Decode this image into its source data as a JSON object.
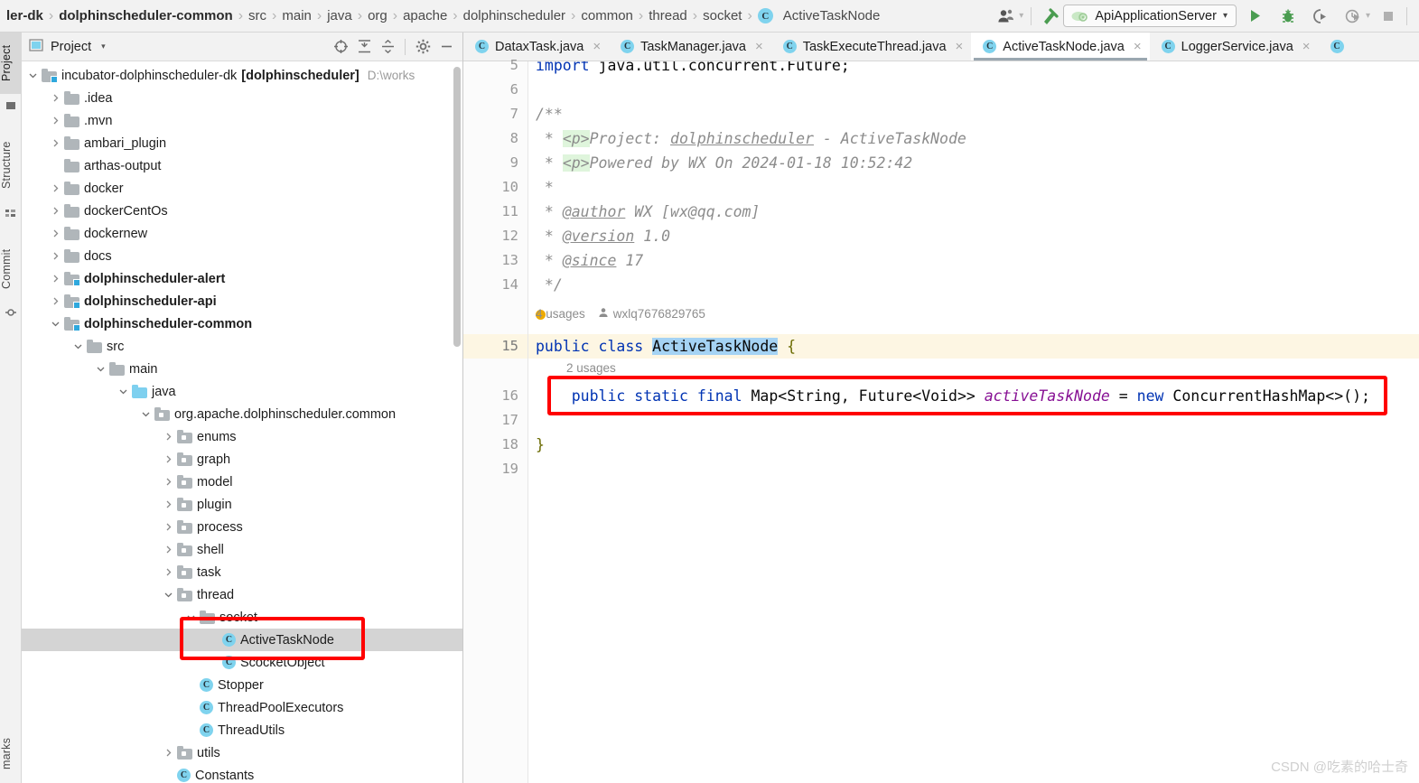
{
  "navbar": {
    "breadcrumbs": [
      {
        "label": "ler-dk",
        "bold": true
      },
      {
        "label": "dolphinscheduler-common",
        "bold": true
      },
      {
        "label": "src",
        "bold": false
      },
      {
        "label": "main",
        "bold": false
      },
      {
        "label": "java",
        "bold": false
      },
      {
        "label": "org",
        "bold": false
      },
      {
        "label": "apache",
        "bold": false
      },
      {
        "label": "dolphinscheduler",
        "bold": false
      },
      {
        "label": "common",
        "bold": false
      },
      {
        "label": "thread",
        "bold": false
      },
      {
        "label": "socket",
        "bold": false
      }
    ],
    "current_class": "ActiveTaskNode",
    "class_icon_letter": "C",
    "separator": "›",
    "icons": {
      "account": "account-icon",
      "account_caret": "▾",
      "build": "build-hammer-icon",
      "run": "run-icon",
      "debug": "debug-icon",
      "run_coverage": "run-with-coverage-icon",
      "profiler": "profiler-icon",
      "profiler_caret": "▾",
      "stop": "stop-icon"
    },
    "run_config": {
      "name": "ApiApplicationServer",
      "caret": "▾",
      "icon": "spring-boot-icon"
    }
  },
  "toolstrip": {
    "tabs": [
      {
        "label": "Project",
        "active": true
      },
      {
        "label": "Structure",
        "active": false
      },
      {
        "label": "Commit",
        "active": false
      },
      {
        "label": "marks",
        "active": false
      }
    ]
  },
  "project_panel": {
    "title": "Project",
    "title_caret": "▾",
    "tools": [
      {
        "name": "select-opened-file-icon",
        "glyph": "⊕"
      },
      {
        "name": "expand-all-icon",
        "glyph": "↧"
      },
      {
        "name": "collapse-all-icon",
        "glyph": "↥"
      },
      {
        "name": "settings-gear-icon",
        "glyph": "⚙"
      },
      {
        "name": "hide-panel-icon",
        "glyph": "—"
      }
    ],
    "tree": [
      {
        "label": "incubator-dolphinscheduler-dk",
        "suffix": "[dolphinscheduler]",
        "path": "D:\\works",
        "indent": 0,
        "twist": "down",
        "icon": "module",
        "bold": false
      },
      {
        "label": ".idea",
        "indent": 1,
        "twist": "right",
        "icon": "folder",
        "bold": false
      },
      {
        "label": ".mvn",
        "indent": 1,
        "twist": "right",
        "icon": "folder",
        "bold": false
      },
      {
        "label": "ambari_plugin",
        "indent": 1,
        "twist": "right",
        "icon": "folder",
        "bold": false
      },
      {
        "label": "arthas-output",
        "indent": 1,
        "twist": "none",
        "icon": "folder",
        "bold": false
      },
      {
        "label": "docker",
        "indent": 1,
        "twist": "right",
        "icon": "folder",
        "bold": false
      },
      {
        "label": "dockerCentOs",
        "indent": 1,
        "twist": "right",
        "icon": "folder",
        "bold": false
      },
      {
        "label": "dockernew",
        "indent": 1,
        "twist": "right",
        "icon": "folder",
        "bold": false
      },
      {
        "label": "docs",
        "indent": 1,
        "twist": "right",
        "icon": "folder",
        "bold": false
      },
      {
        "label": "dolphinscheduler-alert",
        "indent": 1,
        "twist": "right",
        "icon": "module",
        "bold": true
      },
      {
        "label": "dolphinscheduler-api",
        "indent": 1,
        "twist": "right",
        "icon": "module",
        "bold": true
      },
      {
        "label": "dolphinscheduler-common",
        "indent": 1,
        "twist": "down",
        "icon": "module",
        "bold": true
      },
      {
        "label": "src",
        "indent": 2,
        "twist": "down",
        "icon": "folder",
        "bold": false
      },
      {
        "label": "main",
        "indent": 3,
        "twist": "down",
        "icon": "folder",
        "bold": false
      },
      {
        "label": "java",
        "indent": 4,
        "twist": "down",
        "icon": "source",
        "bold": false
      },
      {
        "label": "org.apache.dolphinscheduler.common",
        "indent": 5,
        "twist": "down",
        "icon": "pkg",
        "bold": false
      },
      {
        "label": "enums",
        "indent": 6,
        "twist": "right",
        "icon": "pkg",
        "bold": false
      },
      {
        "label": "graph",
        "indent": 6,
        "twist": "right",
        "icon": "pkg",
        "bold": false
      },
      {
        "label": "model",
        "indent": 6,
        "twist": "right",
        "icon": "pkg",
        "bold": false
      },
      {
        "label": "plugin",
        "indent": 6,
        "twist": "right",
        "icon": "pkg",
        "bold": false
      },
      {
        "label": "process",
        "indent": 6,
        "twist": "right",
        "icon": "pkg",
        "bold": false
      },
      {
        "label": "shell",
        "indent": 6,
        "twist": "right",
        "icon": "pkg",
        "bold": false
      },
      {
        "label": "task",
        "indent": 6,
        "twist": "right",
        "icon": "pkg",
        "bold": false
      },
      {
        "label": "thread",
        "indent": 6,
        "twist": "down",
        "icon": "pkg",
        "bold": false
      },
      {
        "label": "socket",
        "indent": 7,
        "twist": "down",
        "icon": "folder",
        "bold": false
      },
      {
        "label": "ActiveTaskNode",
        "indent": 8,
        "twist": "none",
        "icon": "class",
        "bold": false,
        "selected": true
      },
      {
        "label": "ScocketObject",
        "indent": 8,
        "twist": "none",
        "icon": "class",
        "bold": false
      },
      {
        "label": "Stopper",
        "indent": 7,
        "twist": "none",
        "icon": "class",
        "bold": false
      },
      {
        "label": "ThreadPoolExecutors",
        "indent": 7,
        "twist": "none",
        "icon": "class",
        "bold": false
      },
      {
        "label": "ThreadUtils",
        "indent": 7,
        "twist": "none",
        "icon": "class",
        "bold": false
      },
      {
        "label": "utils",
        "indent": 6,
        "twist": "right",
        "icon": "pkg",
        "bold": false
      },
      {
        "label": "Constants",
        "indent": 6,
        "twist": "none",
        "icon": "class",
        "bold": false
      }
    ]
  },
  "editor": {
    "tabs": [
      {
        "label": "DataxTask.java",
        "active": false,
        "icon": "java-class-run-icon"
      },
      {
        "label": "TaskManager.java",
        "active": false,
        "icon": "java-class-icon"
      },
      {
        "label": "TaskExecuteThread.java",
        "active": false,
        "icon": "java-class-icon"
      },
      {
        "label": "ActiveTaskNode.java",
        "active": true,
        "icon": "java-class-icon"
      },
      {
        "label": "LoggerService.java",
        "active": false,
        "icon": "java-class-icon"
      },
      {
        "label": "",
        "active": false,
        "icon": "java-class-icon"
      }
    ],
    "close_glyph": "×",
    "line_numbers": [
      "5",
      "6",
      "7",
      "8",
      "9",
      "10",
      "11",
      "12",
      "13",
      "14",
      "15",
      "16",
      "17",
      "18",
      "19"
    ],
    "current_line": "15",
    "code_lines": [
      {
        "n": "5",
        "text": "import java.util.concurrent.Future;"
      },
      {
        "n": "6",
        "text": ""
      },
      {
        "n": "7",
        "text": "/**"
      },
      {
        "n": "8",
        "text": " * <p>Project: dolphinscheduler - ActiveTaskNode"
      },
      {
        "n": "9",
        "text": " * <p>Powered by WX On 2024-01-18 10:52:42"
      },
      {
        "n": "10",
        "text": " *"
      },
      {
        "n": "11",
        "text": " * @author WX [wx@qq.com]"
      },
      {
        "n": "12",
        "text": " * @version 1.0"
      },
      {
        "n": "13",
        "text": " * @since 17"
      },
      {
        "n": "14",
        "text": " */"
      },
      {
        "n": "15",
        "text": "public class ActiveTaskNode {"
      },
      {
        "n": "16",
        "text": "    public static final Map<String, Future<Void>> activeTaskNode = new ConcurrentHashMap<>();"
      },
      {
        "n": "17",
        "text": ""
      },
      {
        "n": "18",
        "text": "}"
      },
      {
        "n": "19",
        "text": ""
      }
    ],
    "code_tokens": {
      "import_kw": "import",
      "import_pkg": " java.util.concurrent.Future;",
      "doc_open": "/**",
      "doc_star": " * ",
      "ptag": "<p>",
      "line8_rest_a": "Project: ",
      "line8_link": "dolphinscheduler",
      "line8_rest_b": " - ActiveTaskNode",
      "line9_rest": "Powered by WX On 2024-01-18 10:52:42",
      "line10": " *",
      "author_tag": "@author",
      "author_val": " WX [wx@qq.com]",
      "version_tag": "@version",
      "version_val": " 1.0",
      "since_tag": "@since",
      "since_val": " 17",
      "doc_close": " */",
      "public": "public",
      "class": "class",
      "classname": "ActiveTaskNode",
      "open_brace": "{",
      "indent": "    ",
      "static": "static",
      "final": "final",
      "maptype": "Map<String, ",
      "futuretype": "Future<Void>>",
      "fieldname": "activeTaskNode",
      "equals": "=",
      "new": "new",
      "ctor": "ConcurrentHashMap<>();",
      "close_brace": "}"
    },
    "inlay_hints": [
      {
        "line": "15",
        "usages": "4 usages",
        "author": "wxlq7676829765",
        "has_bulb": true
      },
      {
        "line": "16",
        "usages": "2 usages",
        "author": "",
        "has_bulb": false
      }
    ]
  },
  "annotations": {
    "red_box_tree": "ActiveTaskNode",
    "red_box_code": "public static final Map<String, Future<Void>> activeTaskNode = new ConcurrentHashMap<>();",
    "accent_red": "#ff0000"
  },
  "watermark": {
    "text": "CSDN @吃素的哈士奇"
  },
  "colors": {
    "keyword_blue": "#0033b3",
    "field_purple": "#871094",
    "comment_gray": "#8c8c8c",
    "selection_blue": "#a5d3f4",
    "caret_line": "#fdf6e3",
    "tree_selection": "#d4d4d4",
    "class_icon": "#7fd3ee",
    "run_green": "#4a9c50"
  }
}
